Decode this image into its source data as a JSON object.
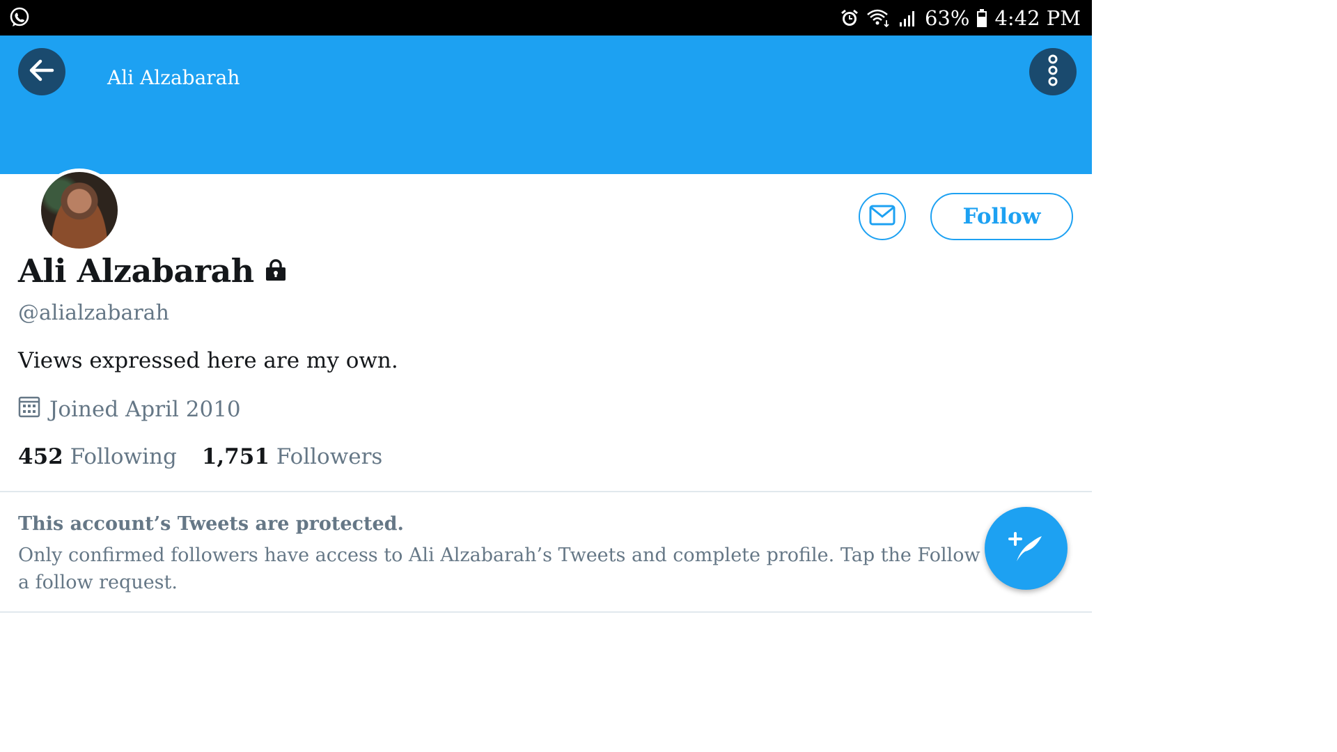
{
  "status_bar": {
    "battery": "63%",
    "time": "4:42 PM",
    "icons": [
      "whatsapp-icon",
      "alarm-icon",
      "wifi-icon",
      "signal-icon",
      "battery-icon"
    ]
  },
  "header": {
    "title": "Ali Alzabarah",
    "back_icon": "arrow-left-icon",
    "more_icon": "more-vertical-icon",
    "background": "#1da1f2"
  },
  "profile": {
    "name": "Ali Alzabarah",
    "handle": "@alialzabarah",
    "bio": "Views expressed here are my own.",
    "joined": "Joined April 2010",
    "following_count": "452",
    "following_label": "Following",
    "followers_count": "1,751",
    "followers_label": "Followers"
  },
  "actions": {
    "follow_label": "Follow",
    "message_icon": "envelope-icon",
    "compose_icon": "compose-tweet-icon"
  },
  "protected": {
    "title": "This account’s Tweets are protected.",
    "line1": "Only confirmed followers have access to Ali Alzabarah’s Tweets and complete profile. Tap the Follow button",
    "line2": "a follow request."
  },
  "colors": {
    "accent": "#1da1f2",
    "dark_button": "#1a4a6e",
    "secondary_text": "#657786",
    "primary_text": "#14171a"
  }
}
